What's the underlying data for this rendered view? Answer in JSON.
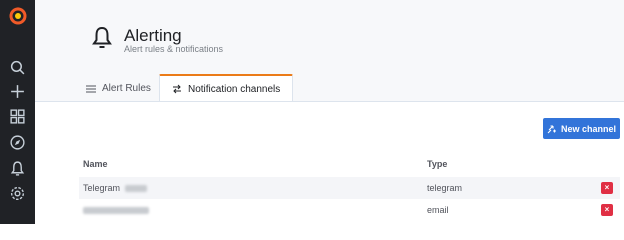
{
  "header": {
    "title": "Alerting",
    "subtitle": "Alert rules & notifications"
  },
  "tabs": [
    {
      "label": "Alert Rules",
      "icon": "list-icon",
      "active": false
    },
    {
      "label": "Notification channels",
      "icon": "channel-icon",
      "active": true
    }
  ],
  "actions": {
    "new_channel_label": "New channel"
  },
  "table": {
    "columns": [
      "Name",
      "Type"
    ],
    "rows": [
      {
        "name": "Telegram",
        "type": "telegram"
      },
      {
        "name": "",
        "type": "email"
      }
    ]
  },
  "sidebar": {
    "items": [
      "grafana-logo-icon",
      "search-icon",
      "plus-icon",
      "dashboards-icon",
      "explore-icon",
      "alerting-bell-icon",
      "settings-gear-icon"
    ]
  },
  "colors": {
    "sidebar_bg": "#202226",
    "accent_orange": "#eb7b18",
    "primary_button": "#3274d9",
    "delete_button": "#e02f44"
  },
  "delete_symbol": "×"
}
